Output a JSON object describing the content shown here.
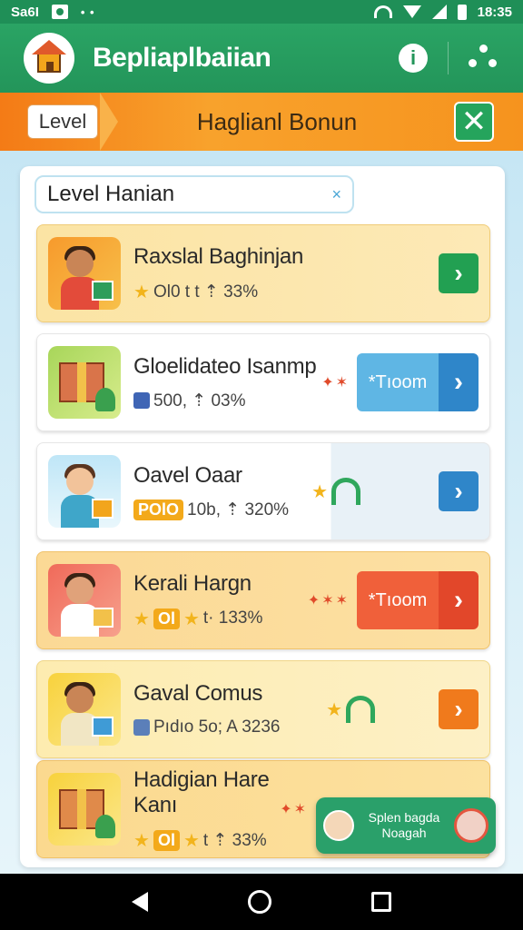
{
  "status_bar": {
    "left_text": "Sa6I",
    "dots": "• •",
    "time": "18:35"
  },
  "app": {
    "title": "Bepliaplbaiian"
  },
  "banner": {
    "level_label": "Level",
    "title": "Haglianl Bonun"
  },
  "search": {
    "value": "Level Hanian",
    "clear": "×"
  },
  "cards": [
    {
      "title": "Raxslal Baghinjan",
      "meta": "Ol0 t t ⇡ 33%",
      "button": "›"
    },
    {
      "title": "Gloelidateo Isanmp",
      "meta": "500, ⇡ 03%",
      "decor": "✦✶",
      "button_label": "*Tıoom",
      "button": "›"
    },
    {
      "title": "Oavel Oaar",
      "badge": "POlO",
      "meta": "10b, ⇡ 320%",
      "button": "›"
    },
    {
      "title": "Kerali Hargn",
      "badge": "Ol",
      "meta": "t· 133%",
      "decor": "✦✶✶",
      "button_label": "*Tıoom",
      "button": "›"
    },
    {
      "title": "Gaval Comus",
      "meta": "Pıdıo 5o; A 3236",
      "button": "›"
    },
    {
      "title": "Hadigian Hare Kanı",
      "badge": "Ol",
      "meta": "t ⇡ 33%",
      "decor": "✦✶"
    }
  ],
  "toast": {
    "line1": "Splen bagda",
    "line2": "Noagah"
  }
}
